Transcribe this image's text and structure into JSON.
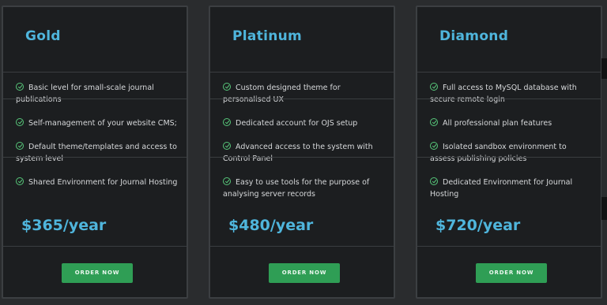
{
  "plans": [
    {
      "name": "Gold",
      "features": [
        "Basic level for small-scale journal publications",
        "Self-management of your website CMS;",
        "Default theme/templates and access to system   level",
        "Shared Environment for Journal Hosting"
      ],
      "price": "$365/year",
      "button": "ORDER NOW"
    },
    {
      "name": "Platinum",
      "features": [
        "Custom designed theme for personalised UX",
        "Dedicated account for OJS setup",
        "Advanced access to the system with Control Panel",
        "Easy to use tools for the purpose of analysing server records"
      ],
      "price": "$480/year",
      "button": "ORDER NOW"
    },
    {
      "name": "Diamond",
      "features": [
        "Full access to MySQL database with secure remote login",
        "All professional plan features",
        "Isolated sandbox environment to assess publishing policies",
        "Dedicated Environment for Journal Hosting"
      ],
      "price": "$720/year",
      "button": "ORDER NOW"
    }
  ],
  "colors": {
    "accent": "#4fb5dc",
    "button": "#2f9e55",
    "check": "#57c77a",
    "card_bg": "#1c1e20"
  },
  "icons": {
    "feature_icon": "check-circle-icon"
  }
}
